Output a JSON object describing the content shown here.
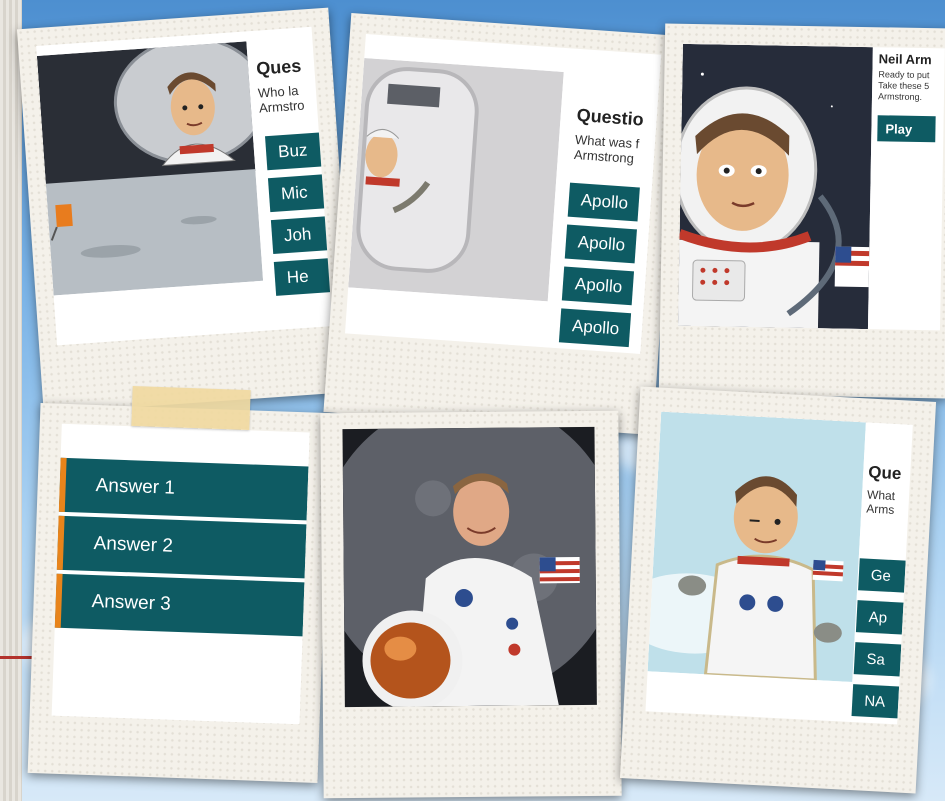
{
  "cards": {
    "q1": {
      "title": "Ques",
      "question": [
        "Who la",
        "Armstro"
      ],
      "answers": [
        "Buz",
        "Mic",
        "Joh",
        "He"
      ]
    },
    "q2": {
      "title": "Questio",
      "question": [
        "What was f",
        "Armstrong"
      ],
      "answers": [
        "Apollo",
        "Apollo",
        "Apollo",
        "Apollo"
      ]
    },
    "intro": {
      "title": "Neil Arm",
      "text": [
        "Ready to put",
        "Take these 5",
        "Armstrong."
      ],
      "play_label": "Play"
    },
    "answers_card": {
      "answers": [
        "Answer 1",
        "Answer 2",
        "Answer 3"
      ]
    },
    "q3": {
      "title": "Que",
      "question": [
        "What",
        "Arms"
      ],
      "answers": [
        "Ge",
        "Ap",
        "Sa",
        "NA"
      ]
    }
  },
  "colors": {
    "answer_bg": "#0e5b63",
    "accent": "#e8841b",
    "sky": "#79b2e6"
  }
}
